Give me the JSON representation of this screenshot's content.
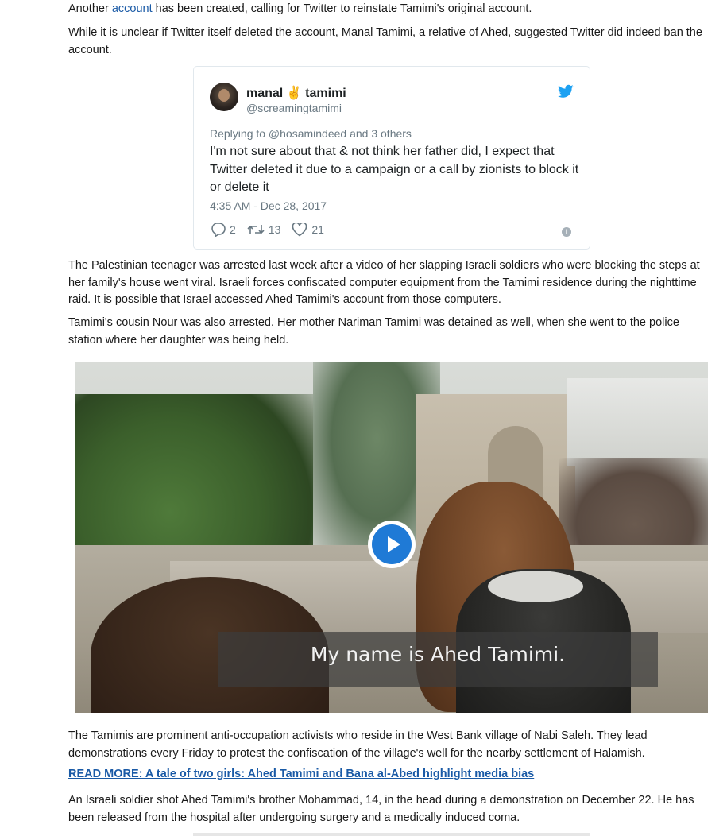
{
  "paragraphs": {
    "p1_before": "Another ",
    "p1_link": "account",
    "p1_after": " has been created, calling for Twitter to reinstate Tamimi's original account.",
    "p2": "While it is unclear if Twitter itself deleted the account, Manal Tamimi, a relative of Ahed, suggested Twitter did indeed ban the account.",
    "p3": "The Palestinian teenager was arrested last week after a video of her slapping Israeli soldiers who were blocking the steps at her family's house went viral. Israeli forces confiscated computer equipment from the Tamimi residence during the nighttime raid. It is possible that Israel accessed Ahed Tamimi's account from those computers.",
    "p4": "Tamimi's cousin Nour was also arrested. Her mother Nariman Tamimi was detained as well, when she went to the police station where her daughter was being held.",
    "p5": "The Tamimis are prominent anti-occupation activists who reside in the West Bank village of Nabi Saleh. They lead demonstrations every Friday to protest the confiscation of the village's well for the nearby settlement of Halamish.",
    "read_more": "READ MORE: A tale of two girls: Ahed Tamimi and Bana al-Abed highlight media bias",
    "p6": "An Israeli soldier shot Ahed Tamimi's brother Mohammad, 14, in the head during a demonstration on December 22. He has been released from the hospital after undergoing surgery and a medically induced coma."
  },
  "tweet": {
    "name_first": "manal",
    "name_emoji": "✌",
    "name_last": "tamimi",
    "handle": "@screamingtamimi",
    "reply_to": "Replying to @hosamindeed and 3 others",
    "text": "I'm not sure about that & not think her father did, I expect that Twitter deleted it due to a campaign or a call by zionists to block it or delete it",
    "timestamp": "4:35 AM - Dec 28, 2017",
    "replies": "2",
    "retweets": "13",
    "likes": "21",
    "icons": [
      "twitter-bird-icon",
      "reply-icon",
      "retweet-icon",
      "heart-icon",
      "info-icon"
    ],
    "colors": {
      "bird": "#1da1f2",
      "muted": "#697882"
    }
  },
  "video": {
    "caption": "My name is Ahed Tamimi.",
    "play_icon": "play-icon",
    "play_color": "#1f7ad6"
  },
  "colors": {
    "link": "#1a5aa6"
  }
}
